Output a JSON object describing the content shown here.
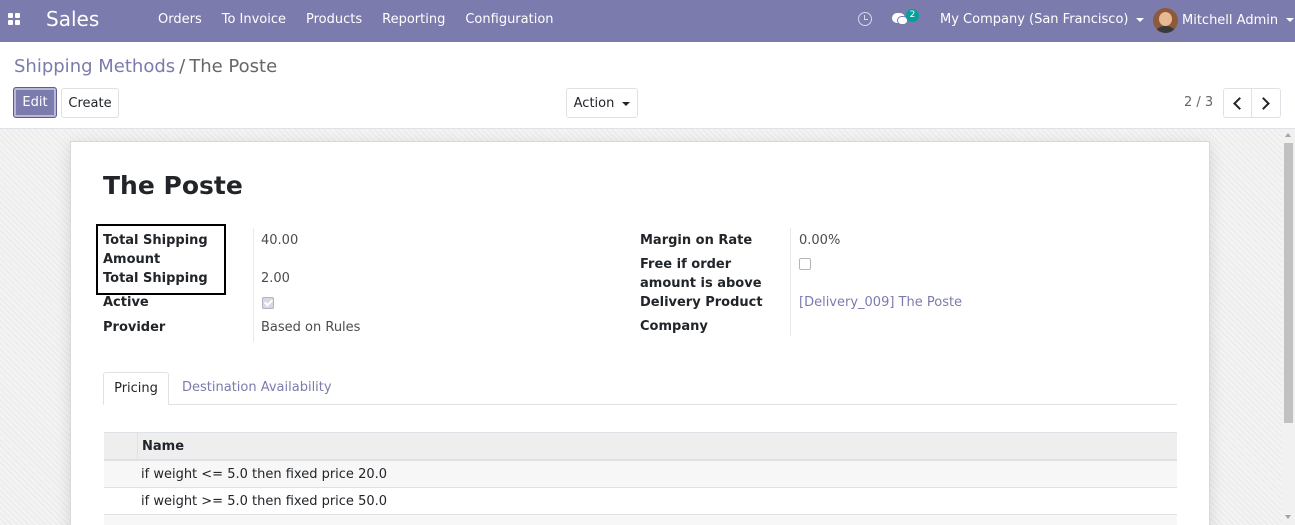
{
  "navbar": {
    "app_name": "Sales",
    "menu": [
      "Orders",
      "To Invoice",
      "Products",
      "Reporting",
      "Configuration"
    ],
    "messages_badge": "2",
    "company": "My Company (San Francisco)",
    "user": "Mitchell Admin",
    "brand_color": "#7c7bad"
  },
  "breadcrumb": {
    "parent": "Shipping Methods",
    "separator": "/",
    "current": "The Poste"
  },
  "toolbar": {
    "edit_label": "Edit",
    "create_label": "Create",
    "action_label": "Action"
  },
  "pager": {
    "value": "2 / 3"
  },
  "record": {
    "title": "The Poste",
    "left_fields": [
      {
        "label": "Total Shipping Amount",
        "value": "40.00"
      },
      {
        "label": "Total Shipping",
        "value": "2.00"
      },
      {
        "label": "Active",
        "checked": true
      },
      {
        "label": "Provider",
        "value": "Based on Rules"
      }
    ],
    "right_fields": [
      {
        "label": "Margin on Rate",
        "value": "0.00%"
      },
      {
        "label": "Free if order amount is above",
        "checked": false
      },
      {
        "label": "Delivery Product",
        "value": "[Delivery_009] The Poste"
      },
      {
        "label": "Company",
        "value": ""
      }
    ]
  },
  "tabs": [
    {
      "label": "Pricing",
      "active": true
    },
    {
      "label": "Destination Availability",
      "active": false
    }
  ],
  "pricing_table": {
    "header": "Name",
    "rows": [
      "if weight <= 5.0 then fixed price 20.0",
      "if weight >= 5.0 then fixed price 50.0",
      ""
    ]
  }
}
